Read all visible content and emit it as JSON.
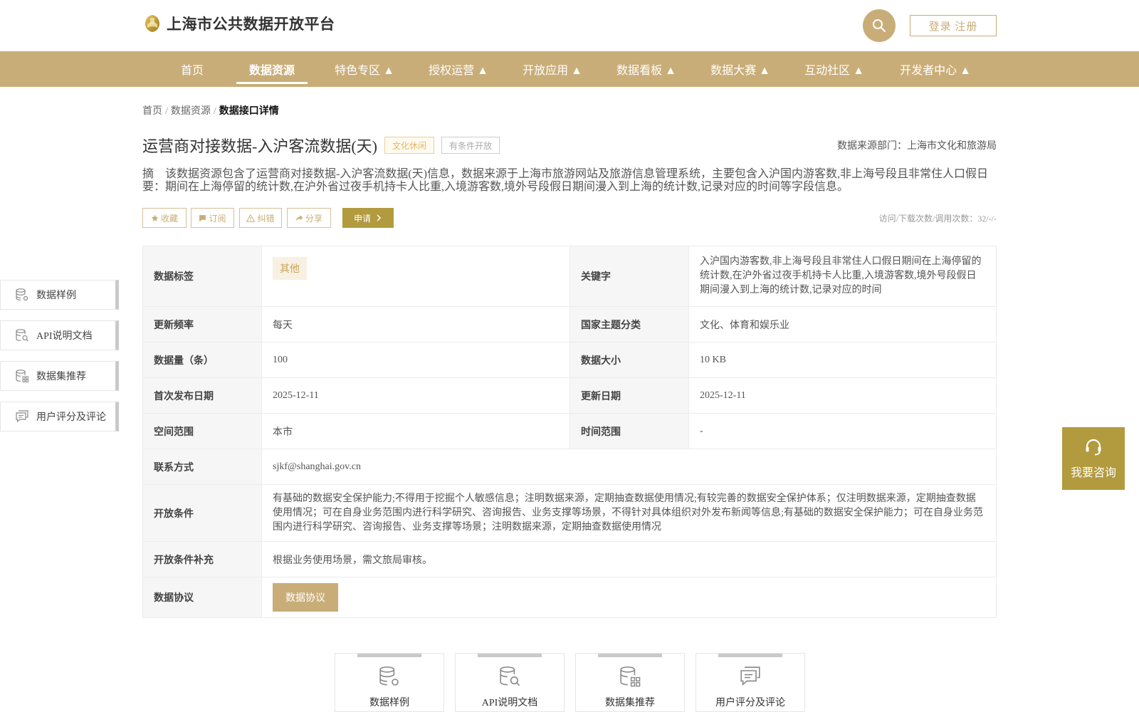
{
  "header": {
    "site_title": "上海市公共数据开放平台",
    "login_label": "登录 注册"
  },
  "nav": [
    {
      "label": "首页"
    },
    {
      "label": "数据资源"
    },
    {
      "label": "特色专区 ▲"
    },
    {
      "label": "授权运营 ▲"
    },
    {
      "label": "开放应用 ▲"
    },
    {
      "label": "数据看板 ▲"
    },
    {
      "label": "数据大赛 ▲"
    },
    {
      "label": "互动社区 ▲"
    },
    {
      "label": "开发者中心 ▲"
    }
  ],
  "breadcrumb": {
    "home": "首页",
    "sep": "/",
    "resources": "数据资源",
    "current": "数据接口详情"
  },
  "dataset": {
    "title": "运营商对接数据-入沪客流数据(天)",
    "tag_culture": "文化休闲",
    "tag_condition": "有条件开放",
    "source": "数据来源部门：上海市文化和旅游局",
    "abstract": "摘　该数据资源包含了运营商对接数据-入沪客流数据(天)信息，数据来源于上海市旅游网站及旅游信息管理系统，主要包含入沪国内游客数,非上海号段且非常住人口假日要：期间在上海停留的统计数,在沪外省过夜手机持卡人比重,入境游客数,境外号段假日期间漫入到上海的统计数,记录对应的时间等字段信息。"
  },
  "actions": {
    "favorite": "收藏",
    "subscribe": "订阅",
    "report": "纠错",
    "share": "分享",
    "apply": "申请",
    "visits": "访问/下载次数/调用次数：32/-/-"
  },
  "table": {
    "tag_label": "数据标签",
    "tag_value": "其他",
    "keyword_label": "关键字",
    "keyword_value": "入沪国内游客数,非上海号段且非常住人口假日期间在上海停留的统计数,在沪外省过夜手机持卡人比重,入境游客数,境外号段假日期间漫入到上海的统计数,记录对应的时间",
    "freq_label": "更新频率",
    "freq_value": "每天",
    "theme_label": "国家主题分类",
    "theme_value": "文化、体育和娱乐业",
    "count_label": "数据量（条）",
    "count_value": "100",
    "size_label": "数据大小",
    "size_value": "10 KB",
    "first_date_label": "首次发布日期",
    "first_date_value": "2025-12-11",
    "update_date_label": "更新日期",
    "update_date_value": "2025-12-11",
    "space_label": "空间范围",
    "space_value": "本市",
    "time_label": "时间范围",
    "time_value": "-",
    "contact_label": "联系方式",
    "contact_value": "sjkf@shanghai.gov.cn",
    "cond_label": "开放条件",
    "cond_value": "有基础的数据安全保护能力;不得用于挖掘个人敏感信息；注明数据来源，定期抽查数据使用情况;有较完善的数据安全保护体系；仅注明数据来源，定期抽查数据使用情况；可在自身业务范围内进行科学研究、咨询报告、业务支撑等场景，不得针对具体组织对外发布新闻等信息;有基础的数据安全保护能力；可在自身业务范围内进行科学研究、咨询报告、业务支撑等场景；注明数据来源，定期抽查数据使用情况",
    "cond_extra_label": "开放条件补充",
    "cond_extra_value": "根据业务使用场景，需文旅局审核。",
    "protocol_label": "数据协议",
    "protocol_button": "数据协议"
  },
  "side_menu": [
    {
      "label": "数据样例",
      "icon": "database-gear-icon"
    },
    {
      "label": "API说明文档",
      "icon": "database-search-icon"
    },
    {
      "label": "数据集推荐",
      "icon": "database-grid-icon"
    },
    {
      "label": "用户评分及评论",
      "icon": "comment-icon"
    }
  ],
  "consult": {
    "label": "我要咨询"
  },
  "cards": [
    {
      "label": "数据样例"
    },
    {
      "label": "API说明文档"
    },
    {
      "label": "数据集推荐"
    },
    {
      "label": "用户评分及评论"
    }
  ],
  "colors": {
    "accent": "#c9ad78",
    "apply": "#b29a3e"
  }
}
